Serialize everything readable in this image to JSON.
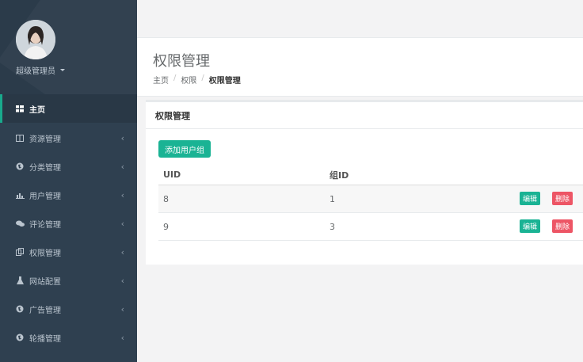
{
  "profile": {
    "name": "超级管理员"
  },
  "nav": [
    {
      "label": "主页",
      "icon": "grid-icon",
      "active": true
    },
    {
      "label": "资源管理",
      "icon": "columns-icon"
    },
    {
      "label": "分类管理",
      "icon": "globe-icon"
    },
    {
      "label": "用户管理",
      "icon": "bar-chart-icon"
    },
    {
      "label": "评论管理",
      "icon": "comments-icon"
    },
    {
      "label": "权限管理",
      "icon": "copy-icon"
    },
    {
      "label": "网站配置",
      "icon": "flask-icon"
    },
    {
      "label": "广告管理",
      "icon": "globe-icon"
    },
    {
      "label": "轮播管理",
      "icon": "globe-icon"
    }
  ],
  "heading": {
    "title": "权限管理",
    "breadcrumb": [
      "主页",
      "权限",
      "权限管理"
    ]
  },
  "panel": {
    "title": "权限管理",
    "add_button": "添加用户组",
    "columns": [
      "UID",
      "组ID"
    ],
    "rows": [
      {
        "uid": "8",
        "gid": "1"
      },
      {
        "uid": "9",
        "gid": "3"
      }
    ],
    "edit_label": "编辑",
    "delete_label": "删除"
  },
  "colors": {
    "sidebar": "#2f4050",
    "accent": "#1ab394",
    "danger": "#ed5565"
  }
}
